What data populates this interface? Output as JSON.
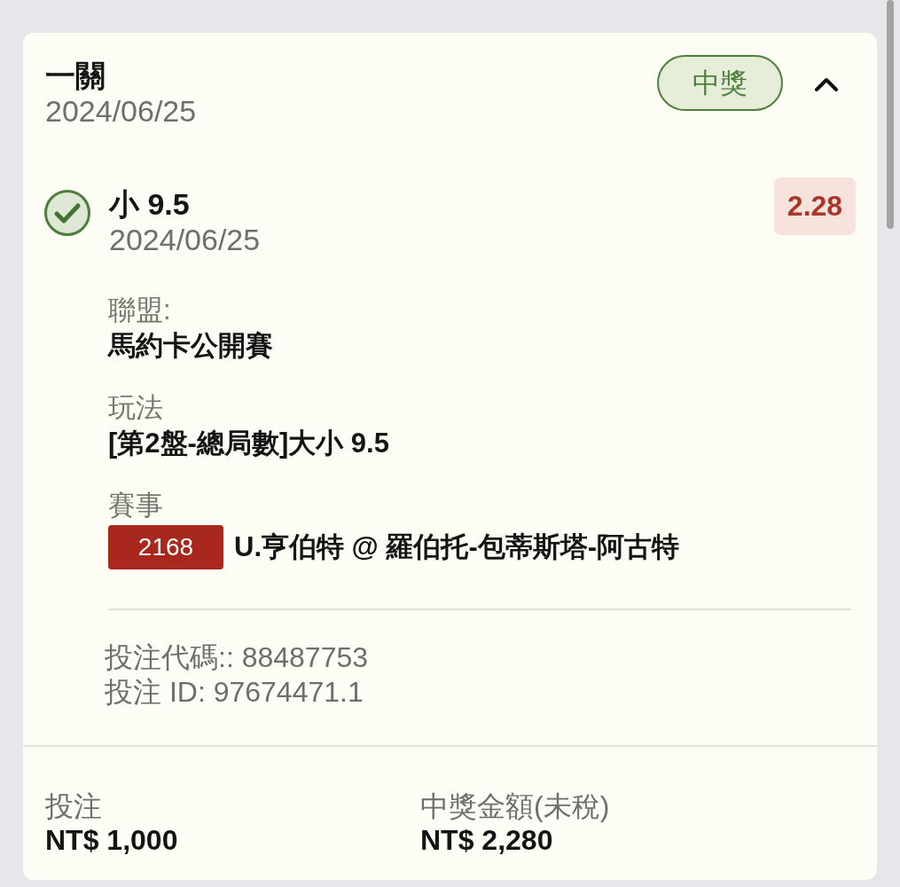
{
  "bet": {
    "type": "一關",
    "date": "2024/06/25",
    "status": "中獎",
    "expanded": true
  },
  "selection": {
    "won": true,
    "pick": "小 9.5",
    "date": "2024/06/25",
    "odds": "2.28",
    "details": [
      {
        "kind": "text",
        "label": "聯盟:",
        "value": "馬約卡公開賽"
      },
      {
        "kind": "text",
        "label": "玩法",
        "value": "[第2盤-總局數]大小 9.5"
      },
      {
        "kind": "event",
        "label": "賽事",
        "event_no": "2168",
        "value": "U.亨伯特 @ 羅伯托-包蒂斯塔-阿古特"
      }
    ]
  },
  "codes": [
    "投注代碼:: 88487753",
    "投注 ID: 97674471.1"
  ],
  "totals": [
    {
      "label": "投注",
      "value": "NT$ 1,000"
    },
    {
      "label": "中獎金額(未稅)",
      "value": "NT$ 2,280"
    }
  ]
}
